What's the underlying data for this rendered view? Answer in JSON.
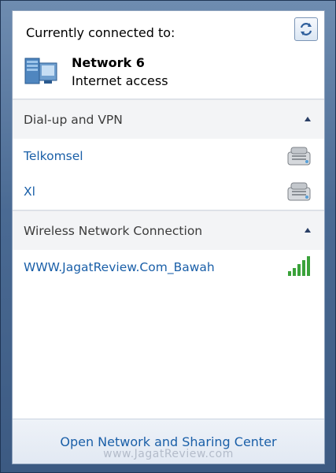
{
  "current": {
    "title": "Currently connected to:",
    "network_name": "Network  6",
    "network_status": "Internet access"
  },
  "sections": [
    {
      "header": "Dial-up and VPN",
      "items": [
        {
          "label": "Telkomsel",
          "icon": "dialup-modem-icon"
        },
        {
          "label": "Xl",
          "icon": "dialup-modem-icon"
        }
      ]
    },
    {
      "header": "Wireless Network Connection",
      "items": [
        {
          "label": "WWW.JagatReview.Com_Bawah",
          "icon": "wifi-signal-icon",
          "signal_bars": 5
        }
      ]
    }
  ],
  "footer": {
    "link": "Open Network and Sharing Center",
    "watermark": "www.JagatReview.com"
  },
  "colors": {
    "link": "#1a5fa8",
    "signal_green": "#3aa23a"
  }
}
